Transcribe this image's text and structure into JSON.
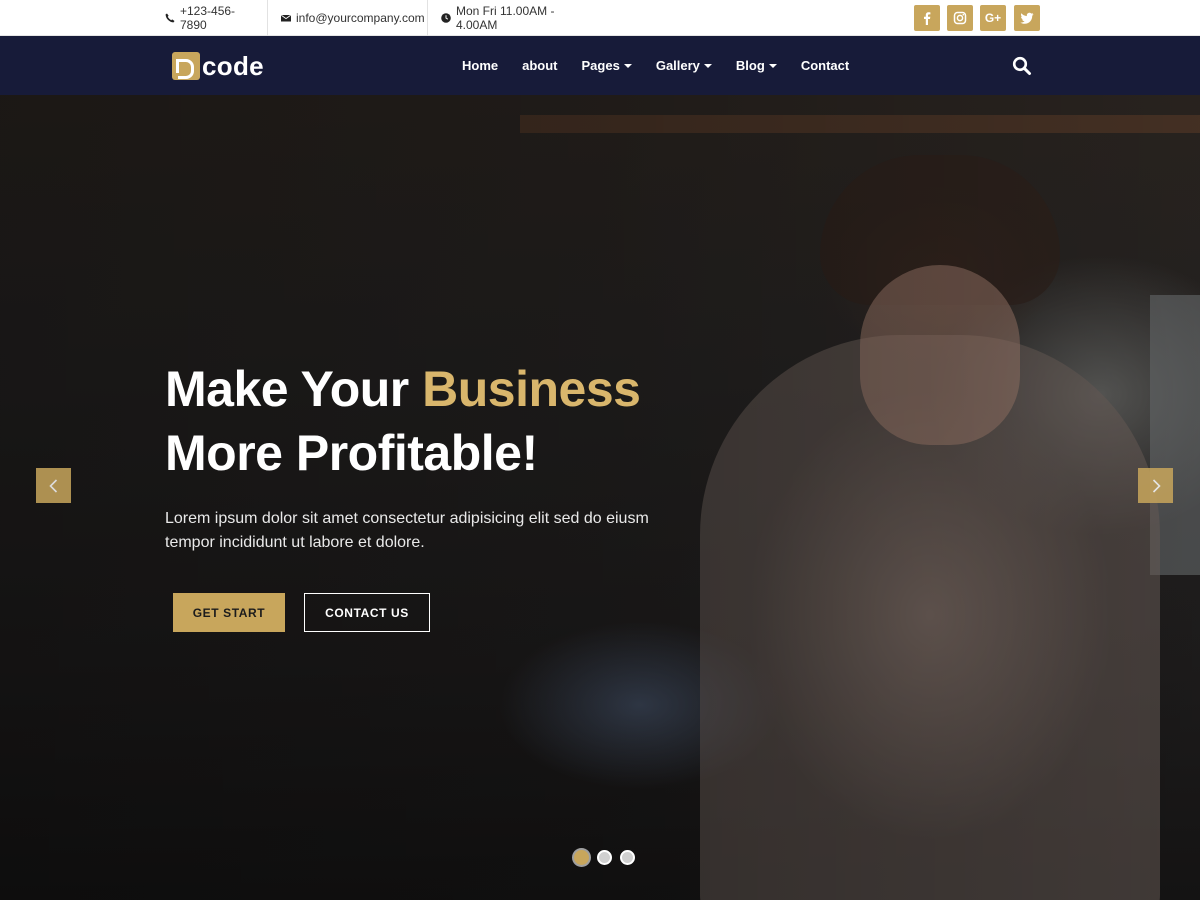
{
  "topbar": {
    "phone": "+123-456-7890",
    "email": "info@yourcompany.com",
    "hours": "Mon Fri 11.00AM - 4.00AM",
    "social": [
      {
        "name": "facebook-icon"
      },
      {
        "name": "instagram-icon"
      },
      {
        "name": "google-plus-icon",
        "label": "G+"
      },
      {
        "name": "twitter-icon"
      }
    ]
  },
  "navbar": {
    "logo_text": "code",
    "items": [
      {
        "label": "Home",
        "dropdown": false
      },
      {
        "label": "about",
        "dropdown": false
      },
      {
        "label": "Pages",
        "dropdown": true
      },
      {
        "label": "Gallery",
        "dropdown": true
      },
      {
        "label": "Blog",
        "dropdown": true
      },
      {
        "label": "Contact",
        "dropdown": false
      }
    ]
  },
  "hero": {
    "headline_part1": "Make Your ",
    "headline_accent": "Business",
    "headline_line2": "More Profitable!",
    "subtext": "Lorem ipsum dolor sit amet consectetur adipisicing elit sed do eiusm tempor incididunt ut labore et dolore.",
    "primary_button": "GET START",
    "secondary_button": "CONTACT US",
    "slides": 3,
    "active_slide": 1
  },
  "colors": {
    "accent": "#c8a65c",
    "navbar_bg": "#171b39",
    "topbar_bg": "#ffffff"
  }
}
